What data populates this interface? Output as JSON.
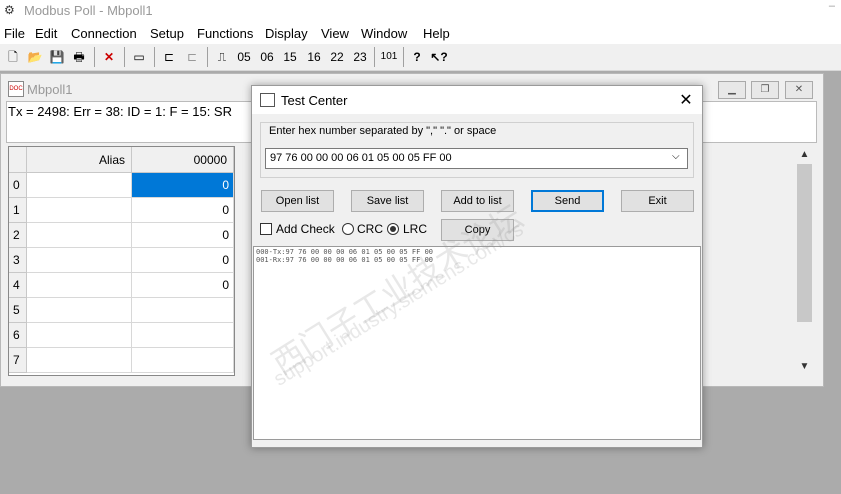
{
  "app": {
    "title": "Modbus Poll - Mbpoll1"
  },
  "menu": [
    "File",
    "Edit",
    "Connection",
    "Setup",
    "Functions",
    "Display",
    "View",
    "Window",
    "Help"
  ],
  "toolbar": {
    "fc_buttons": [
      "05",
      "06",
      "15",
      "16",
      "22",
      "23"
    ],
    "extra_label": "101"
  },
  "child": {
    "title": "Mbpoll1",
    "status": "Tx = 2498: Err = 38: ID = 1: F = 15: SR",
    "grid": {
      "col_alias": "Alias",
      "col_addr": "00000",
      "rows": [
        {
          "idx": "0",
          "value": "0"
        },
        {
          "idx": "1",
          "value": "0"
        },
        {
          "idx": "2",
          "value": "0"
        },
        {
          "idx": "3",
          "value": "0"
        },
        {
          "idx": "4",
          "value": "0"
        },
        {
          "idx": "5",
          "value": ""
        },
        {
          "idx": "6",
          "value": ""
        },
        {
          "idx": "7",
          "value": ""
        }
      ]
    }
  },
  "dialog": {
    "title": "Test Center",
    "close_glyph": "✕",
    "group_label": "Enter hex number separated by \",\"  \".\" or space",
    "combo_value": "97 76 00 00 00 06 01 05 00 05 FF 00",
    "buttons": {
      "open": "Open list",
      "save": "Save list",
      "add": "Add to list",
      "send": "Send",
      "exit": "Exit",
      "copy": "Copy"
    },
    "add_check_label": "Add Check",
    "crc_label": "CRC",
    "lrc_label": "LRC",
    "log": [
      "000-Tx:97 76 00 00 00 06 01 05 00 05 FF 00",
      "001-Rx:97 76 00 00 00 06 01 05 00 05 FF 00"
    ]
  },
  "watermark": {
    "line1": "西门子工业技术论坛",
    "line2": "support.industry.siemens.com/cs"
  }
}
